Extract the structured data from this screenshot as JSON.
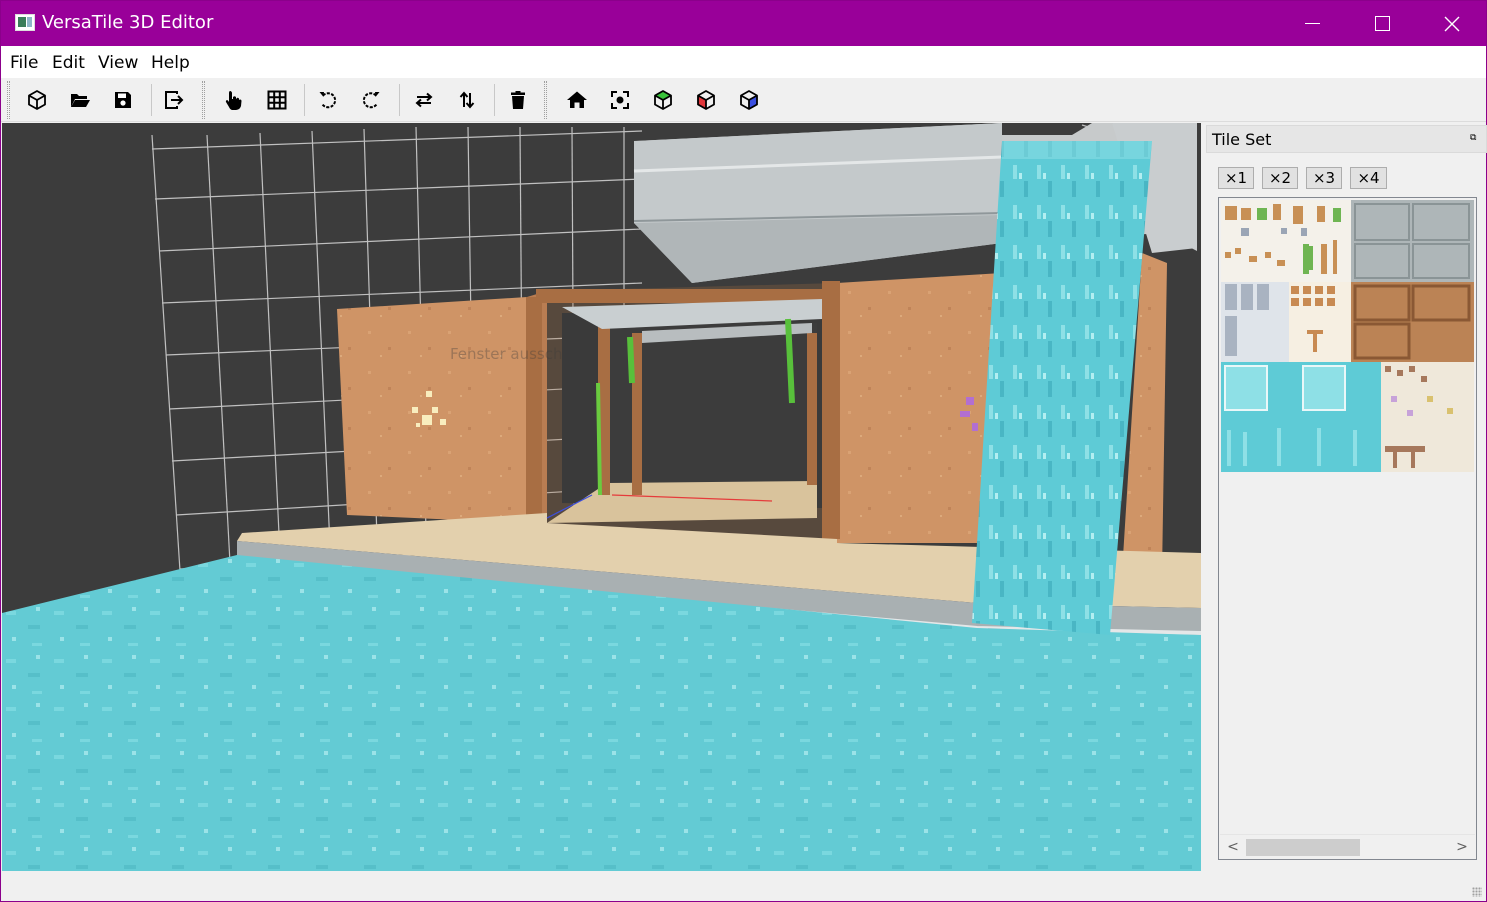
{
  "window": {
    "title": "VersaTile 3D Editor",
    "accent_color": "#990099"
  },
  "menubar": {
    "items": [
      {
        "label": "File"
      },
      {
        "label": "Edit"
      },
      {
        "label": "View"
      },
      {
        "label": "Help"
      }
    ]
  },
  "toolbar": {
    "groups": [
      [
        "new-model-icon",
        "open-file-icon",
        "save-icon",
        "export-icon"
      ],
      [
        "hand-pointer-icon",
        "grid-icon",
        "rotate-ccw-icon",
        "rotate-cw-icon",
        "flip-horizontal-icon",
        "flip-vertical-icon",
        "delete-icon"
      ],
      [
        "home-view-icon",
        "fit-view-icon",
        "green-cube-icon",
        "red-cube-icon",
        "blue-cube-icon"
      ]
    ]
  },
  "viewport": {
    "ghost_text": "Fenster ausschnei"
  },
  "tileset": {
    "title": "Tile Set",
    "zoom_buttons": [
      "×1",
      "×2",
      "×3",
      "×4"
    ]
  }
}
